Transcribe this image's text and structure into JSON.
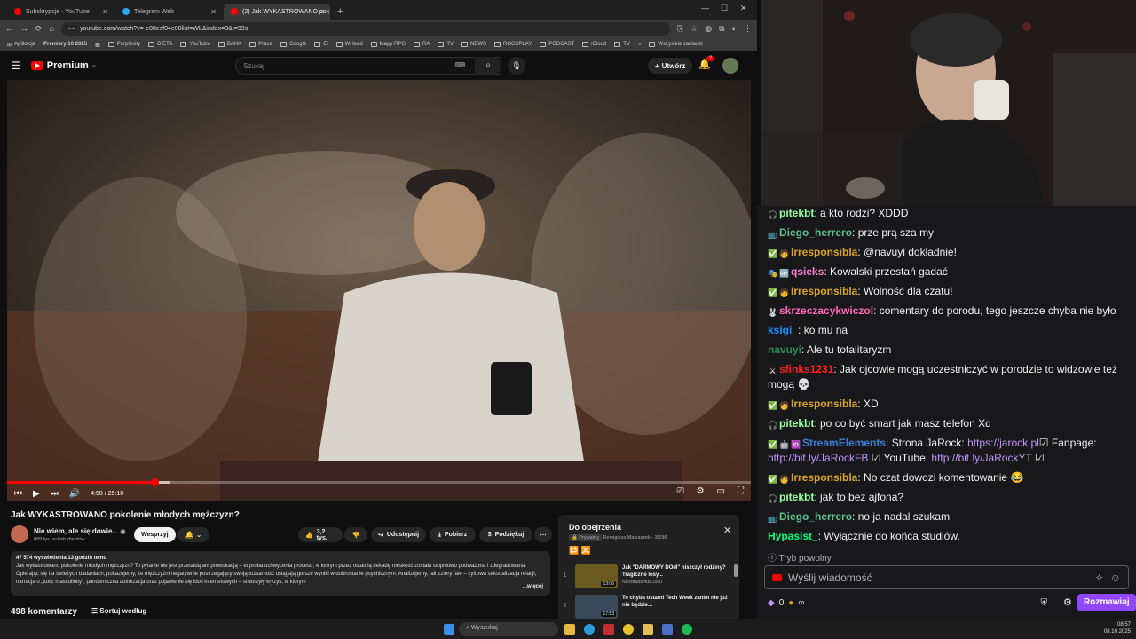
{
  "browser": {
    "tabs": [
      {
        "label": "Subskrypcje - YouTube",
        "color": "#ff0000"
      },
      {
        "label": "Telegram Web",
        "color": "#2aabee"
      },
      {
        "label": "(2) Jak WYKASTROWANO pok",
        "color": "#ff0000"
      }
    ],
    "url": "youtube.com/watch?v=-e08esf04e08list=WL&index=3&t=99s",
    "bookmarks": [
      "Aplikacje",
      "Premiery 10 2025",
      "Perplexity",
      "DIETA",
      "YouTube",
      "BANK",
      "Praca",
      "Google",
      "El",
      "WHead",
      "Mapy RPG",
      "RA",
      "TV",
      "NEWS",
      "ROCKPLAY",
      "PODCAST",
      "iCloud",
      "TV"
    ],
    "all_bookmarks": "Wszystkie zakładki"
  },
  "yt_header": {
    "logo": "Premium",
    "logo_region": "PL",
    "search_placeholder": "Szukaj",
    "create_label": "Utwórz",
    "notifications": "2"
  },
  "player": {
    "time": "4:58 / 25:10",
    "progress": 0.198
  },
  "video": {
    "title": "Jak WYKASTROWANO pokolenie młodych mężczyzn?",
    "channel": "Nie wiem, ale się dowie...",
    "subscribers": "889 tys. subskrybentów",
    "support_label": "Wesprzyj",
    "likes": "3,2 tys.",
    "share_label": "Udostępnij",
    "download_label": "Pobierz",
    "thanks_label": "Podziękuj",
    "stats": "47 574 wyświetlenia  13 godzin temu",
    "description": "Jak wykastrowano pokolenie młodych mężczyzn? To pytanie nie jest przesadą ani prowokacją – to próba uchwycenia procesu, w którym przez ostatnią dekadę męskość została stopniowo podważona i zdegradowana. Opierając się na świeżych badaniach, pokazujemy, że mężczyźni negatywnie postrzegający swoją tożsamość osiągają gorsze wyniki w dobrostanie psychicznym. Analizujemy, jak cztery fale – cyfrowa seksualizacja relacji, narracja o „toxic masculinity\", pandemiczna atomizacja oraz pojawienie się idoli internetowych – stworzyły kryzys, w którym",
    "more_label": "...więcej",
    "comments_count": "498 komentarzy",
    "sort_label": "Sortuj według"
  },
  "playlist": {
    "title": "Do obejrzenia",
    "privacy": "Prywatny",
    "owner_progress": "Remigiusz Maciaszek - 3/196",
    "items": [
      {
        "num": "1",
        "title": "Jak \"DARMOWY DOM\" niszczył rodziny? Tragiczne losy...",
        "channel": "Neostradamus 2000",
        "duration": "13:06",
        "thumb": "#6a5a20"
      },
      {
        "num": "2",
        "title": "To chyba ostatni Tech Week zanim nie już nie będzie...",
        "channel": "",
        "duration": "17:53",
        "thumb": "#3a4a5a"
      }
    ]
  },
  "chat": {
    "messages": [
      {
        "user": "pitekbt",
        "color": "#9aff9a",
        "badges": [
          "🎧"
        ],
        "text": ": a kto rodzi? XDDD"
      },
      {
        "user": "Diego_herrero",
        "color": "#5cc18b",
        "badges": [
          "📺"
        ],
        "text": ": prze prą sza my"
      },
      {
        "user": "Irresponsibla",
        "color": "#daa520",
        "badges": [
          "✅",
          "🧑"
        ],
        "text": ": @navuyi dokładnie!"
      },
      {
        "user": "qsieks",
        "color": "#ff7fd0",
        "badges": [
          "🎭",
          "🆙"
        ],
        "text": ": Kowalski przestań gadać"
      },
      {
        "user": "Irresponsibla",
        "color": "#daa520",
        "badges": [
          "✅",
          "🧑"
        ],
        "text": ": Wolność dla czatu!"
      },
      {
        "user": "skrzeczacykwiczol",
        "color": "#ff69b4",
        "badges": [
          "🐰"
        ],
        "text": ": comentary do porodu, tego jeszcze chyba nie było"
      },
      {
        "user": "ksigi_",
        "color": "#1e90ff",
        "badges": [],
        "text": ": ko mu na"
      },
      {
        "user": "navuyi",
        "color": "#2e8b57",
        "badges": [],
        "text": ": Ale tu totalitaryzm"
      },
      {
        "user": "sfinks1231",
        "color": "#ff2020",
        "badges": [
          "⚔"
        ],
        "text": ": Jak ojcowie mogą uczestniczyć w porodzie to widzowie też mogą 💀"
      },
      {
        "user": "Irresponsibla",
        "color": "#daa520",
        "badges": [
          "✅",
          "🧑"
        ],
        "text": ": XD"
      },
      {
        "user": "pitekbt",
        "color": "#9aff9a",
        "badges": [
          "🎧"
        ],
        "text": ": po co być smart jak masz telefon Xd"
      },
      {
        "user": "StreamElements",
        "color": "#3a7fd6",
        "badges": [
          "✅",
          "🤖",
          "🆔"
        ],
        "text": ": Strona JaRock: ",
        "links": [
          "https://jarock.pl",
          "☑ Fanpage: ",
          "http://bit.ly/JaRockFB",
          " ☑ YouTube: ",
          "http://bit.ly/JaRockYT",
          " ☑"
        ]
      },
      {
        "user": "Irresponsibla",
        "color": "#daa520",
        "badges": [
          "✅",
          "🧑"
        ],
        "text": ": No czat dowozi komentowanie 😂"
      },
      {
        "user": "pitekbt",
        "color": "#9aff9a",
        "badges": [
          "🎧"
        ],
        "text": ": jak to bez ajfona?"
      },
      {
        "user": "Diego_herrero",
        "color": "#5cc18b",
        "badges": [
          "📺"
        ],
        "text": ": no ja nadal szukam"
      },
      {
        "user": "Hypasist_",
        "color": "#00ff7f",
        "badges": [],
        "text": ": Wyłącznie do końca studiów."
      }
    ],
    "slow_mode": "Tryb powolny",
    "input_placeholder": "Wyślij wiadomość",
    "points": "0",
    "points_extra": "∞",
    "send_label": "Rozmawiaj"
  },
  "taskbar": {
    "search_placeholder": "Wyszukaj",
    "time": "08:57",
    "date": "08.10.2025"
  }
}
